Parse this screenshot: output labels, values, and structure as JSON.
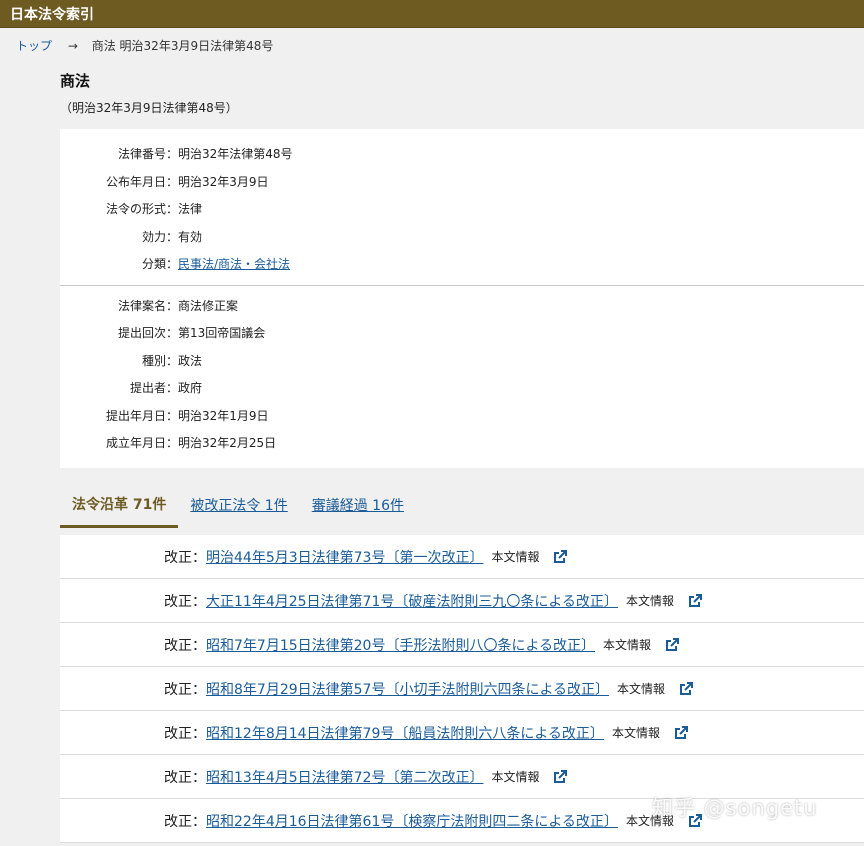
{
  "header": {
    "title": "日本法令索引"
  },
  "breadcrumb": {
    "home": "トップ",
    "arrow": "→",
    "current": "商法 明治32年3月9日法律第48号"
  },
  "law": {
    "title": "商法",
    "subtitle": "（明治32年3月9日法律第48号）"
  },
  "info_primary": [
    {
      "label": "法律番号：",
      "value": "明治32年法律第48号"
    },
    {
      "label": "公布年月日：",
      "value": "明治32年3月9日"
    },
    {
      "label": "法令の形式：",
      "value": "法律"
    },
    {
      "label": "効力：",
      "value": "有効"
    },
    {
      "label": "分類：",
      "value": "民事法/商法・会社法"
    }
  ],
  "info_secondary": [
    {
      "label": "法律案名：",
      "value": "商法修正案"
    },
    {
      "label": "提出回次：",
      "value": "第13回帝国議会"
    },
    {
      "label": "種別：",
      "value": "政法"
    },
    {
      "label": "提出者：",
      "value": "政府"
    },
    {
      "label": "提出年月日：",
      "value": "明治32年1月9日"
    },
    {
      "label": "成立年月日：",
      "value": "明治32年2月25日"
    }
  ],
  "tabs": [
    {
      "label": "法令沿革 71件"
    },
    {
      "label": "被改正法令 1件"
    },
    {
      "label": "審議経過 16件"
    }
  ],
  "amendments": [
    {
      "kind": "改正：",
      "law": "明治44年5月3日法律第73号〔第一次改正〕",
      "info": "本文情報"
    },
    {
      "kind": "改正：",
      "law": "大正11年4月25日法律第71号〔破産法附則三九〇条による改正〕",
      "info": "本文情報"
    },
    {
      "kind": "改正：",
      "law": "昭和7年7月15日法律第20号〔手形法附則八〇条による改正〕",
      "info": "本文情報"
    },
    {
      "kind": "改正：",
      "law": "昭和8年7月29日法律第57号〔小切手法附則六四条による改正〕",
      "info": "本文情報"
    },
    {
      "kind": "改正：",
      "law": "昭和12年8月14日法律第79号〔船員法附則六八条による改正〕",
      "info": "本文情報"
    },
    {
      "kind": "改正：",
      "law": "昭和13年4月5日法律第72号〔第二次改正〕",
      "info": "本文情報"
    },
    {
      "kind": "改正：",
      "law": "昭和22年4月16日法律第61号〔検察庁法附則四二条による改正〕",
      "info": "本文情報"
    }
  ],
  "watermark": "知乎 @songetu",
  "icons": {
    "external": "external-link-icon"
  },
  "colors": {
    "accent": "#6e5b22",
    "link": "#1a5b9a"
  }
}
